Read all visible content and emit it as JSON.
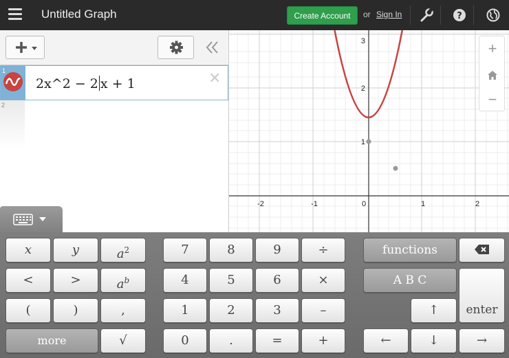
{
  "header": {
    "menu_icon": "hamburger-menu-icon",
    "title": "Untitled Graph",
    "create_account": "Create Account",
    "or": "or",
    "sign_in": "Sign In",
    "icons": [
      "wrench-icon",
      "help-icon",
      "globe-icon"
    ]
  },
  "expressions": {
    "add_icon": "plus-icon",
    "settings_icon": "gear-icon",
    "collapse_icon": "double-chevron-left-icon",
    "items": [
      {
        "index": "1",
        "formula_before_caret": "2x^2 − 2",
        "formula_after_caret": "x + 1",
        "color": "#c74440"
      },
      {
        "index": "2"
      }
    ]
  },
  "graph": {
    "x_ticks": [
      "-2",
      "-1",
      "0",
      "1",
      "2"
    ],
    "y_ticks": [
      "1",
      "2",
      "3"
    ],
    "curve_color": "#c74440",
    "points": [
      {
        "x": 0,
        "y": 1
      },
      {
        "x": 0.5,
        "y": 0.5
      }
    ],
    "zoom": {
      "in": "+",
      "home_icon": "home-icon",
      "out": "−"
    }
  },
  "keypad": {
    "toggle_icon": "keyboard-icon",
    "x": "x",
    "y": "y",
    "a": "a",
    "two": "2",
    "b": "b",
    "lt": "<",
    "gt": ">",
    "lparen": "(",
    "rparen": ")",
    "comma": ",",
    "more": "more",
    "sqrt": "√",
    "n7": "7",
    "n8": "8",
    "n9": "9",
    "div": "÷",
    "n4": "4",
    "n5": "5",
    "n6": "6",
    "mul": "×",
    "n1": "1",
    "n2": "2",
    "n3": "3",
    "minus": "–",
    "n0": "0",
    "dot": ".",
    "eq": "=",
    "plus": "+",
    "functions": "functions",
    "abc": "A B C",
    "enter": "enter",
    "up": "↑",
    "left": "←",
    "down": "↓",
    "right": "→"
  }
}
